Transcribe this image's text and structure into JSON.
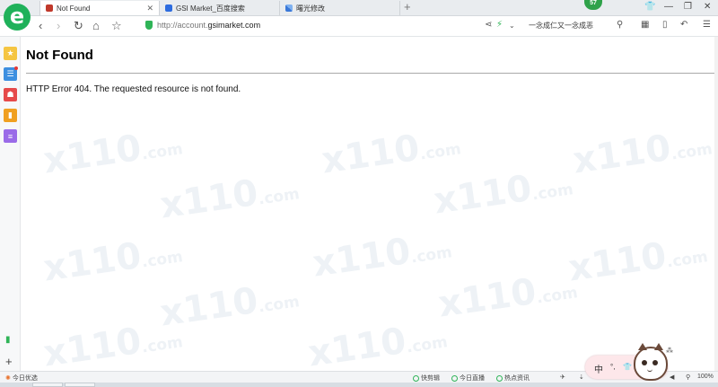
{
  "tabs": [
    {
      "label": "Not Found",
      "active": true
    },
    {
      "label": "GSI Market_百度搜索",
      "active": false
    },
    {
      "label": "曙光修改",
      "active": false
    }
  ],
  "badge_count": "57",
  "address": {
    "prefix": "http://account.",
    "domain": "gsimarket.com"
  },
  "search_query": "一念成仁又一念成恶",
  "page": {
    "title": "Not Found",
    "message": "HTTP Error 404. The requested resource is not found."
  },
  "watermark": {
    "text": "x110",
    "suffix": ".com"
  },
  "status": {
    "left_label": "今日优选",
    "items": [
      "快剪辑",
      "今日直播",
      "热点资讯"
    ],
    "zoom": "100%"
  },
  "ime": {
    "mode": "中"
  },
  "icons": {
    "logo": "browser-e-logo",
    "back": "back-arrow-icon",
    "forward": "forward-arrow-icon",
    "reload": "reload-icon",
    "home": "home-icon",
    "bookmark": "star-icon",
    "shield": "shield-icon",
    "share": "share-icon",
    "lightning": "lightning-icon",
    "search": "search-icon"
  },
  "colors": {
    "accent": "#1fb15a",
    "rule": "#a9a9a9",
    "text": "#000000"
  }
}
